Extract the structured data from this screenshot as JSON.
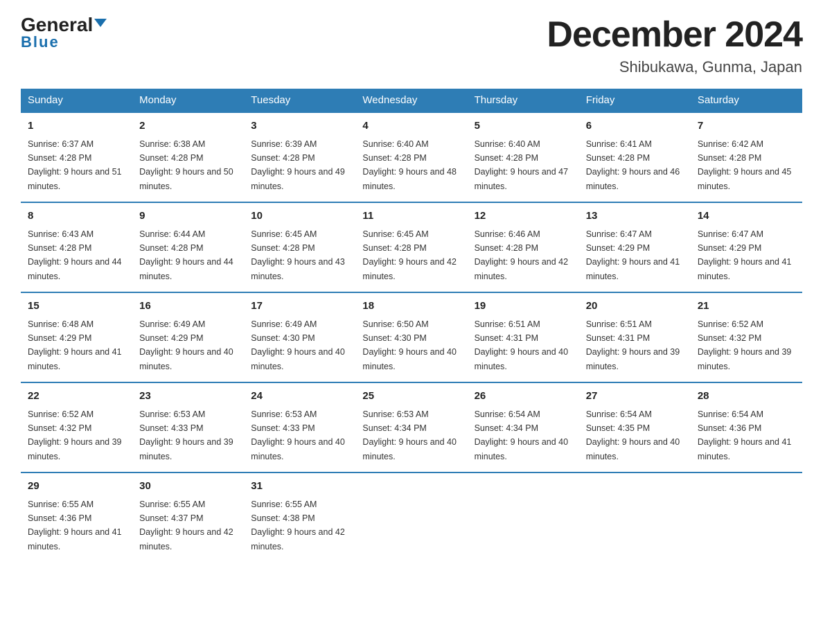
{
  "header": {
    "title": "December 2024",
    "subtitle": "Shibukawa, Gunma, Japan",
    "logo_general": "General",
    "logo_blue": "Blue"
  },
  "columns": [
    "Sunday",
    "Monday",
    "Tuesday",
    "Wednesday",
    "Thursday",
    "Friday",
    "Saturday"
  ],
  "weeks": [
    [
      {
        "day": "1",
        "sunrise": "6:37 AM",
        "sunset": "4:28 PM",
        "daylight": "9 hours and 51 minutes."
      },
      {
        "day": "2",
        "sunrise": "6:38 AM",
        "sunset": "4:28 PM",
        "daylight": "9 hours and 50 minutes."
      },
      {
        "day": "3",
        "sunrise": "6:39 AM",
        "sunset": "4:28 PM",
        "daylight": "9 hours and 49 minutes."
      },
      {
        "day": "4",
        "sunrise": "6:40 AM",
        "sunset": "4:28 PM",
        "daylight": "9 hours and 48 minutes."
      },
      {
        "day": "5",
        "sunrise": "6:40 AM",
        "sunset": "4:28 PM",
        "daylight": "9 hours and 47 minutes."
      },
      {
        "day": "6",
        "sunrise": "6:41 AM",
        "sunset": "4:28 PM",
        "daylight": "9 hours and 46 minutes."
      },
      {
        "day": "7",
        "sunrise": "6:42 AM",
        "sunset": "4:28 PM",
        "daylight": "9 hours and 45 minutes."
      }
    ],
    [
      {
        "day": "8",
        "sunrise": "6:43 AM",
        "sunset": "4:28 PM",
        "daylight": "9 hours and 44 minutes."
      },
      {
        "day": "9",
        "sunrise": "6:44 AM",
        "sunset": "4:28 PM",
        "daylight": "9 hours and 44 minutes."
      },
      {
        "day": "10",
        "sunrise": "6:45 AM",
        "sunset": "4:28 PM",
        "daylight": "9 hours and 43 minutes."
      },
      {
        "day": "11",
        "sunrise": "6:45 AM",
        "sunset": "4:28 PM",
        "daylight": "9 hours and 42 minutes."
      },
      {
        "day": "12",
        "sunrise": "6:46 AM",
        "sunset": "4:28 PM",
        "daylight": "9 hours and 42 minutes."
      },
      {
        "day": "13",
        "sunrise": "6:47 AM",
        "sunset": "4:29 PM",
        "daylight": "9 hours and 41 minutes."
      },
      {
        "day": "14",
        "sunrise": "6:47 AM",
        "sunset": "4:29 PM",
        "daylight": "9 hours and 41 minutes."
      }
    ],
    [
      {
        "day": "15",
        "sunrise": "6:48 AM",
        "sunset": "4:29 PM",
        "daylight": "9 hours and 41 minutes."
      },
      {
        "day": "16",
        "sunrise": "6:49 AM",
        "sunset": "4:29 PM",
        "daylight": "9 hours and 40 minutes."
      },
      {
        "day": "17",
        "sunrise": "6:49 AM",
        "sunset": "4:30 PM",
        "daylight": "9 hours and 40 minutes."
      },
      {
        "day": "18",
        "sunrise": "6:50 AM",
        "sunset": "4:30 PM",
        "daylight": "9 hours and 40 minutes."
      },
      {
        "day": "19",
        "sunrise": "6:51 AM",
        "sunset": "4:31 PM",
        "daylight": "9 hours and 40 minutes."
      },
      {
        "day": "20",
        "sunrise": "6:51 AM",
        "sunset": "4:31 PM",
        "daylight": "9 hours and 39 minutes."
      },
      {
        "day": "21",
        "sunrise": "6:52 AM",
        "sunset": "4:32 PM",
        "daylight": "9 hours and 39 minutes."
      }
    ],
    [
      {
        "day": "22",
        "sunrise": "6:52 AM",
        "sunset": "4:32 PM",
        "daylight": "9 hours and 39 minutes."
      },
      {
        "day": "23",
        "sunrise": "6:53 AM",
        "sunset": "4:33 PM",
        "daylight": "9 hours and 39 minutes."
      },
      {
        "day": "24",
        "sunrise": "6:53 AM",
        "sunset": "4:33 PM",
        "daylight": "9 hours and 40 minutes."
      },
      {
        "day": "25",
        "sunrise": "6:53 AM",
        "sunset": "4:34 PM",
        "daylight": "9 hours and 40 minutes."
      },
      {
        "day": "26",
        "sunrise": "6:54 AM",
        "sunset": "4:34 PM",
        "daylight": "9 hours and 40 minutes."
      },
      {
        "day": "27",
        "sunrise": "6:54 AM",
        "sunset": "4:35 PM",
        "daylight": "9 hours and 40 minutes."
      },
      {
        "day": "28",
        "sunrise": "6:54 AM",
        "sunset": "4:36 PM",
        "daylight": "9 hours and 41 minutes."
      }
    ],
    [
      {
        "day": "29",
        "sunrise": "6:55 AM",
        "sunset": "4:36 PM",
        "daylight": "9 hours and 41 minutes."
      },
      {
        "day": "30",
        "sunrise": "6:55 AM",
        "sunset": "4:37 PM",
        "daylight": "9 hours and 42 minutes."
      },
      {
        "day": "31",
        "sunrise": "6:55 AM",
        "sunset": "4:38 PM",
        "daylight": "9 hours and 42 minutes."
      },
      null,
      null,
      null,
      null
    ]
  ]
}
